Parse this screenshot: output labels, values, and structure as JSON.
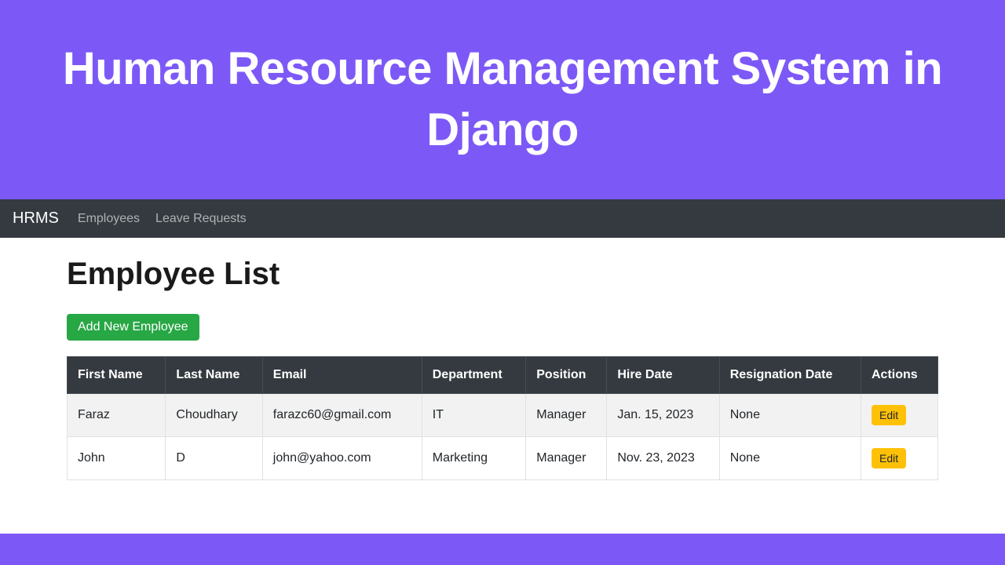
{
  "hero": {
    "title": "Human Resource Management System in Django"
  },
  "navbar": {
    "brand": "HRMS",
    "links": [
      {
        "label": "Employees"
      },
      {
        "label": "Leave Requests"
      }
    ]
  },
  "page": {
    "title": "Employee List",
    "add_button": "Add New Employee",
    "columns": {
      "first_name": "First Name",
      "last_name": "Last Name",
      "email": "Email",
      "department": "Department",
      "position": "Position",
      "hire_date": "Hire Date",
      "resignation_date": "Resignation Date",
      "actions": "Actions"
    },
    "rows": [
      {
        "first_name": "Faraz",
        "last_name": "Choudhary",
        "email": "farazc60@gmail.com",
        "department": "IT",
        "position": "Manager",
        "hire_date": "Jan. 15, 2023",
        "resignation_date": "None",
        "edit_label": "Edit"
      },
      {
        "first_name": "John",
        "last_name": "D",
        "email": "john@yahoo.com",
        "department": "Marketing",
        "position": "Manager",
        "hire_date": "Nov. 23, 2023",
        "resignation_date": "None",
        "edit_label": "Edit"
      }
    ]
  }
}
